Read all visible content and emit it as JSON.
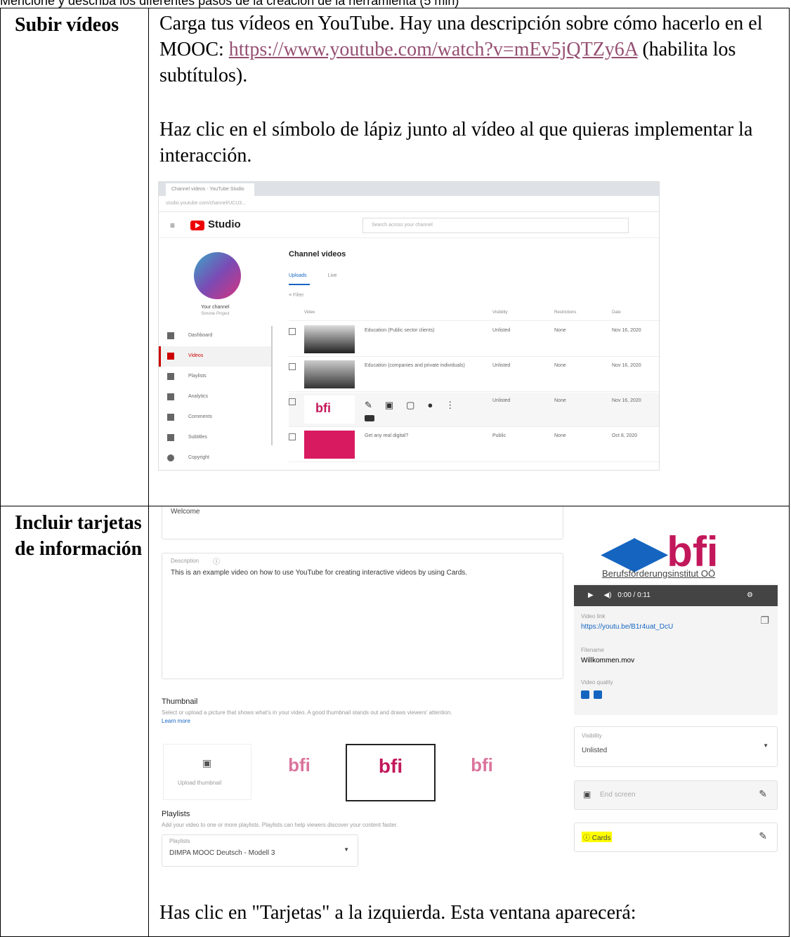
{
  "page_top_text": "Mencione y describa los diferentes pasos de la creación de la herramienta (5 min)",
  "rows": [
    {
      "label": "Subir vídeos",
      "paragraph1_text": "Carga tus vídeos en YouTube. Hay una descripción sobre cómo hacerlo en el MOOC: ",
      "link_text": "https://www.youtube.com/watch?v=mEv5jQTZy6A",
      "paragraph1_suffix": " (habilita los subtítulos).",
      "paragraph2": "Haz clic en el símbolo de lápiz junto al vídeo al  que quieras implementar la interacción."
    },
    {
      "label": "Incluir tarjetas de información",
      "paragraph": "Has clic en \"Tarjetas\" a la izquierda. Esta ventana aparecerá:"
    }
  ],
  "screenshot1": {
    "tab_title": "Channel videos - YouTube Studio",
    "url": "studio.youtube.com/channel/UCU3...",
    "logo_text": "Studio",
    "search_placeholder": "Search across your channel",
    "channel_name": "Your channel",
    "channel_sub": "Simone Project",
    "sidebar": [
      "Dashboard",
      "Videos",
      "Playlists",
      "Analytics",
      "Comments",
      "Subtitles",
      "Copyright"
    ],
    "title": "Channel videos",
    "tabs": [
      "Uploads",
      "Live"
    ],
    "filter": "Filter",
    "headers": [
      "Video",
      "Visibility",
      "Restrictions",
      "Date"
    ],
    "videos": [
      {
        "title": "Education (Public sector clients)",
        "vis": "Unlisted",
        "res": "None",
        "date": "Nov 16, 2020"
      },
      {
        "title": "Education (companies and private individuals)",
        "vis": "Unlisted",
        "res": "None",
        "date": "Nov 16, 2020"
      },
      {
        "title": "",
        "vis": "Unlisted",
        "res": "None",
        "date": "Nov 16, 2020"
      },
      {
        "title": "Get any real digital?",
        "vis": "Public",
        "res": "None",
        "date": "Oct 8, 2020"
      }
    ]
  },
  "screenshot2": {
    "title_value": "Welcome",
    "description_label": "Description",
    "description_text": "This is an example video on how to use YouTube for creating interactive videos by using Cards.",
    "thumbnail_heading": "Thumbnail",
    "thumbnail_help": "Select or upload a picture that shows what's in your video. A good thumbnail stands out and draws viewers' attention.",
    "learn_more": "Learn more",
    "upload_thumbnail": "Upload thumbnail",
    "logo_word": "bfi",
    "logo_caption": "Berufsförderungsinstitut OÖ",
    "playlists_heading": "Playlists",
    "playlists_help": "Add your video to one or more playlists. Playlists can help viewers discover your content faster.",
    "playlists_label": "Playlists",
    "playlists_value": "DIMPA MOOC Deutsch - Modell 3",
    "player_time": "0:00 / 0:11",
    "video_link_label": "Video link",
    "video_link": "https://youtu.be/B1r4uat_DcU",
    "filename_label": "Filename",
    "filename": "Willkommen.mov",
    "video_quality_label": "Video quality",
    "visibility_label": "Visibility",
    "visibility_value": "Unlisted",
    "end_screen": "End screen",
    "cards": "Cards"
  }
}
